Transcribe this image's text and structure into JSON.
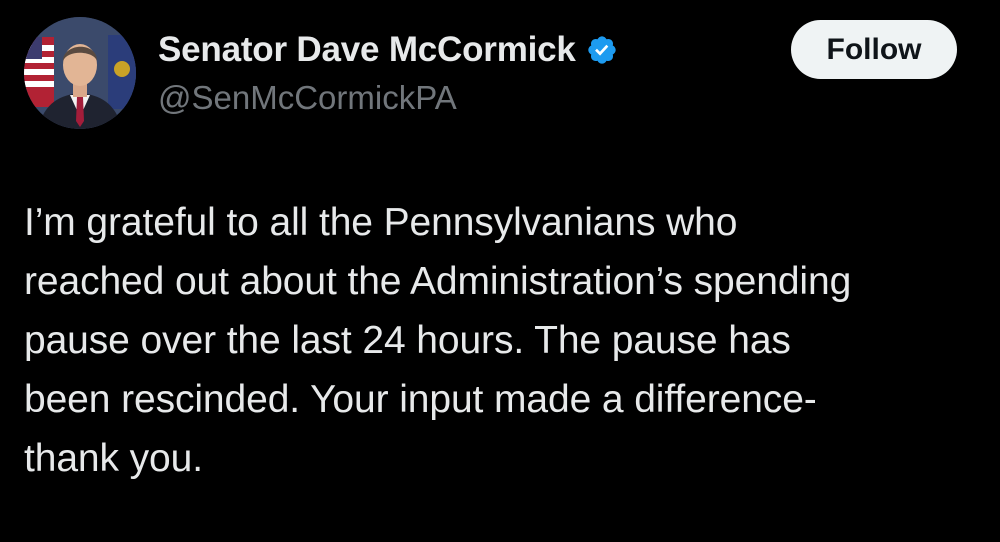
{
  "author": {
    "display_name": "Senator Dave McCormick",
    "handle": "@SenMcCormickPA",
    "verified_icon": "verified-badge-icon",
    "avatar_icon": "avatar"
  },
  "actions": {
    "follow_label": "Follow"
  },
  "tweet": {
    "text": "I’m grateful to all the Pennsylvanians who\nreached out about the Administration’s spending\npause over the last 24 hours. The pause has\nbeen rescinded. Your input made a difference-\nthank you."
  },
  "colors": {
    "background": "#000000",
    "text_primary": "#e7e9ea",
    "text_secondary": "#71767b",
    "verified_blue": "#1d9bf0",
    "follow_bg": "#eff3f4",
    "follow_text": "#0f1419"
  }
}
